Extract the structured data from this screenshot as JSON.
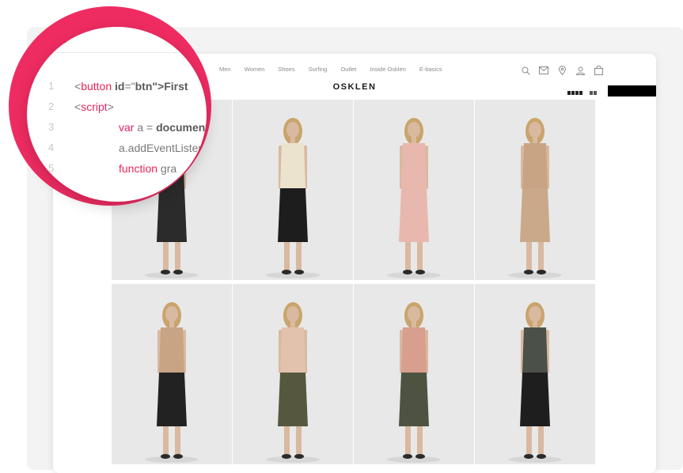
{
  "site": {
    "nav_links": [
      "Men",
      "Women",
      "Shoes",
      "Surfing",
      "Outlet",
      "Inside Osklen",
      "E-basics"
    ],
    "brand": "OSKLEN",
    "icons": [
      "search-icon",
      "mail-icon",
      "location-pin-icon",
      "user-icon",
      "shopping-bag-icon"
    ],
    "view_icons": [
      "grid-4-icon",
      "grid-2-icon"
    ]
  },
  "products": [
    {
      "top": "#2b2b2b",
      "bottom": "#2b2b2b",
      "skin": "#d9b9a0"
    },
    {
      "top": "#ece3cf",
      "bottom": "#1d1d1d",
      "skin": "#d9b9a0"
    },
    {
      "top": "#e8b8ae",
      "bottom": "#e8b8ae",
      "skin": "#d9b9a0"
    },
    {
      "top": "#c8a485",
      "bottom": "#c9a98a",
      "skin": "#d9b9a0"
    },
    {
      "top": "#c8a485",
      "bottom": "#222222",
      "skin": "#d9b9a0"
    },
    {
      "top": "#e2c1ad",
      "bottom": "#55583f",
      "skin": "#d9b9a0"
    },
    {
      "top": "#d89e8e",
      "bottom": "#4d5340",
      "skin": "#d9b9a0"
    },
    {
      "top": "#4b5149",
      "bottom": "#1e1e1e",
      "skin": "#d9b9a0"
    }
  ],
  "code": {
    "lines": [
      {
        "number": "1",
        "parts": [
          [
            "t",
            "<"
          ],
          [
            "p",
            "button"
          ],
          [
            "t",
            " "
          ],
          [
            "b",
            "id"
          ],
          [
            "t",
            "=\""
          ],
          [
            "b",
            "btn\">First"
          ]
        ]
      },
      {
        "number": "2",
        "parts": [
          [
            "t",
            "<"
          ],
          [
            "p",
            "script"
          ],
          [
            "t",
            ">"
          ]
        ]
      },
      {
        "number": "3",
        "parts": [
          [
            "p",
            "var"
          ],
          [
            "t",
            " a = "
          ],
          [
            "b",
            "document"
          ]
        ]
      },
      {
        "number": "4",
        "parts": [
          [
            "t",
            "a.addEventListener"
          ]
        ]
      },
      {
        "number": "5",
        "parts": [
          [
            "p",
            "function"
          ],
          [
            "t",
            " gra"
          ]
        ]
      }
    ]
  },
  "colors": {
    "accent": "#ef2c62",
    "keyword": "#e8255b"
  }
}
